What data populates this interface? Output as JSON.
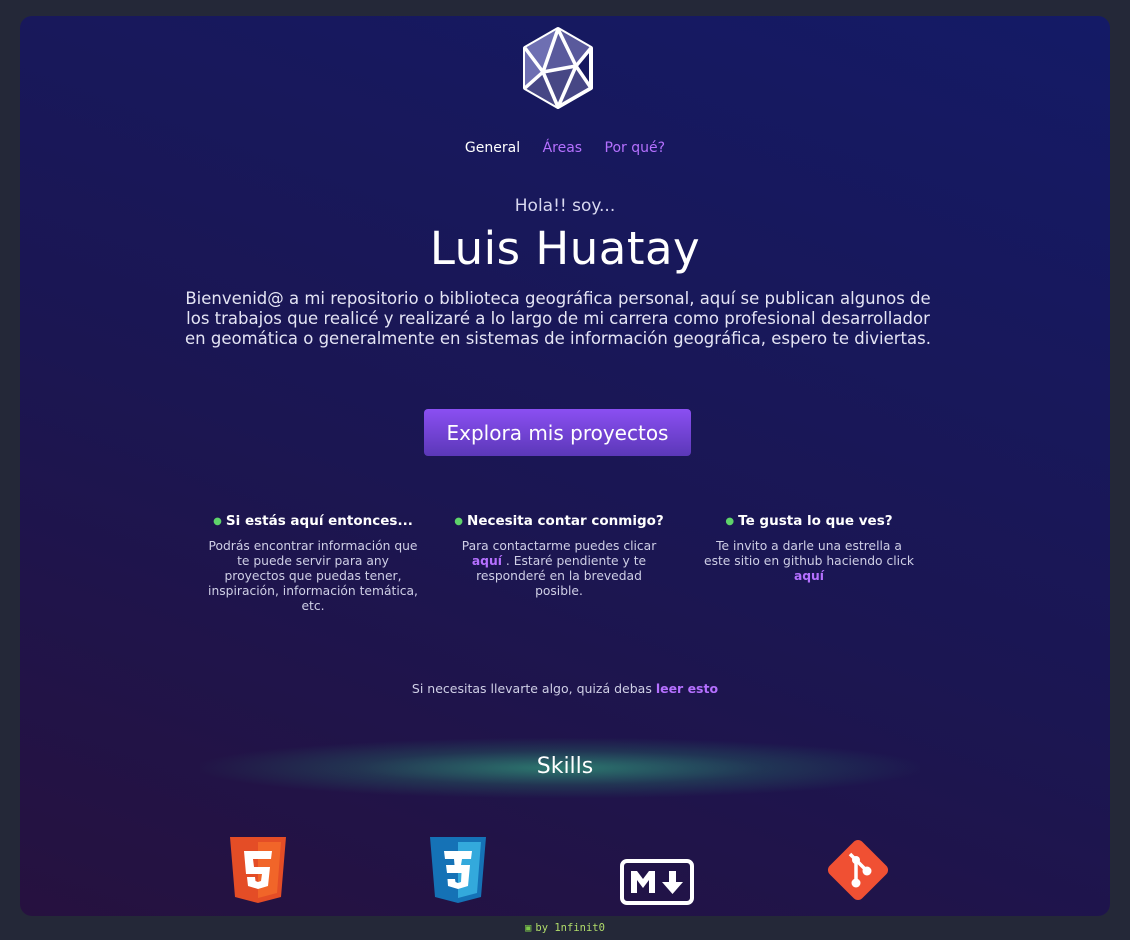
{
  "nav": {
    "items": [
      {
        "label": "General",
        "active": true
      },
      {
        "label": "Áreas",
        "active": false
      },
      {
        "label": "Por qué?",
        "active": false
      }
    ]
  },
  "hero": {
    "greeting": "Hola!! soy...",
    "name": "Luis Huatay",
    "intro": "Bienvenid@ a mi repositorio o biblioteca geográfica personal, aquí se publican algunos de los trabajos que realicé y realizaré a lo largo de mi carrera como profesional desarrollador en geomática o generalmente en sistemas de información geográfica, espero te diviertas.",
    "cta_label": "Explora mis proyectos"
  },
  "columns": [
    {
      "title": "Si estás aquí entonces...",
      "text": "Podrás encontrar información que te puede servir para any proyectos que puedas tener, inspiración, información temática, etc."
    },
    {
      "title": "Necesita contar conmigo?",
      "text_before": "Para contactarme puedes clicar",
      "link": "aquí",
      "text_after": ". Estaré pendiente y te responderé en la brevedad posible."
    },
    {
      "title": "Te gusta lo que ves?",
      "text_before": "Te invito a darle una estrella a este sitio en github haciendo click",
      "link": "aquí"
    }
  ],
  "note": {
    "text": "Si necesitas llevarte algo, quizá debas",
    "link": "leer esto"
  },
  "skills": {
    "title": "Skills",
    "icons": [
      "html5-icon",
      "css3-icon",
      "markdown-icon",
      "git-icon"
    ]
  },
  "footer": {
    "icon": "camera-icon",
    "text": "by 1nfinit0"
  },
  "colors": {
    "accent": "#b570ff",
    "button_top": "#8b4ff2",
    "button_bottom": "#5b38b8",
    "html5": "#e44d26",
    "css3": "#1572b6",
    "git": "#f05033",
    "bullet": "#5ed36a"
  }
}
